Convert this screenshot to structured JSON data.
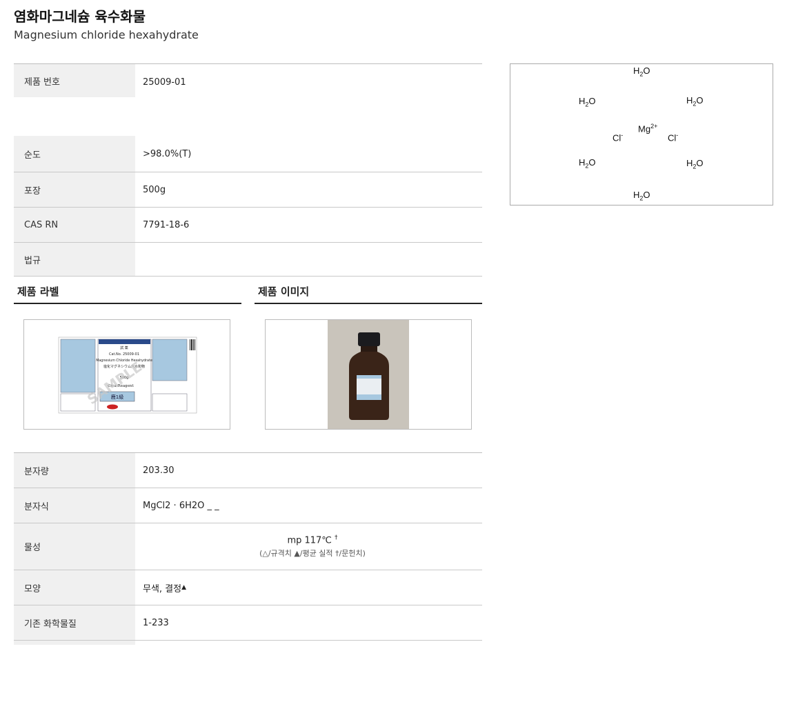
{
  "header": {
    "title": "염화마그네슘 육수화물",
    "subtitle": "Magnesium chloride hexahydrate"
  },
  "spec_top": {
    "product_no_label": "제품 번호",
    "product_no_value": "25009-01",
    "purity_label": "순도",
    "purity_value": ">98.0%(T)",
    "package_label": "포장",
    "package_value": "500g",
    "cas_label": "CAS RN",
    "cas_value": "7791-18-6",
    "law_label": "법규",
    "law_value": ""
  },
  "sections": {
    "label_title": "제품 라벨",
    "image_title": "제품 이미지"
  },
  "label_image": {
    "lot_text": "Cat.No. 25009-01",
    "en_name": "Magnesium Chloride Hexahydrate",
    "jp_name": "塩化マグネシウム六水和物",
    "amount": "500g",
    "brand": "Cica-Reagent",
    "grade": "鹿1級",
    "watermark": "SAMPLE",
    "header_text": "試 薬"
  },
  "spec_bottom": {
    "mw_label": "분자량",
    "mw_value": "203.30",
    "mf_label": "분자식",
    "mf_value": "MgCl2 · 6H2O _ _",
    "prop_label": "물성",
    "prop_value": "mp 117℃",
    "prop_mark": "†",
    "prop_note": "(△/규격치 ▲/평균 실적 †/문헌치)",
    "shape_label": "모양",
    "shape_value": "무색, 결정",
    "shape_mark": "▲",
    "exist_label": "기존 화학물질",
    "exist_value": "1-233"
  },
  "structure": {
    "water": "H",
    "water_sub": "2",
    "water_o": "O",
    "mg": "Mg",
    "mg_charge": "2+",
    "cl": "Cl",
    "cl_charge": "-"
  },
  "colors": {
    "label_blue": "#a7c8e0",
    "bottle_brown": "#3a2418"
  }
}
